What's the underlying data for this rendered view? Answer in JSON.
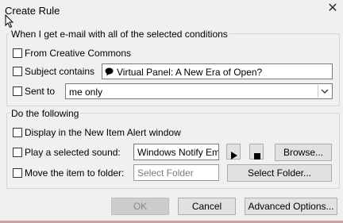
{
  "window": {
    "title": "Create Rule"
  },
  "conditions": {
    "heading": "When I get e-mail with all of the selected conditions",
    "from_label": "From Creative Commons",
    "subject_label": "Subject contains",
    "subject_value": "Virtual Panel: A New Era of Open?",
    "sent_to_label": "Sent to",
    "sent_to_value": "me only"
  },
  "actions": {
    "heading": "Do the following",
    "alert_label": "Display in the New Item Alert window",
    "sound_label": "Play a selected sound:",
    "sound_value": "Windows Notify Em",
    "browse_label": "Browse...",
    "move_label": "Move the item to folder:",
    "folder_placeholder": "Select Folder",
    "select_folder_label": "Select Folder..."
  },
  "footer": {
    "ok_label": "OK",
    "cancel_label": "Cancel",
    "advanced_label": "Advanced Options..."
  },
  "icons": {
    "close": "close-icon",
    "subject": "speech-bubble-icon",
    "play": "play-icon",
    "stop": "stop-icon",
    "dropdown": "chevron-down-icon"
  }
}
